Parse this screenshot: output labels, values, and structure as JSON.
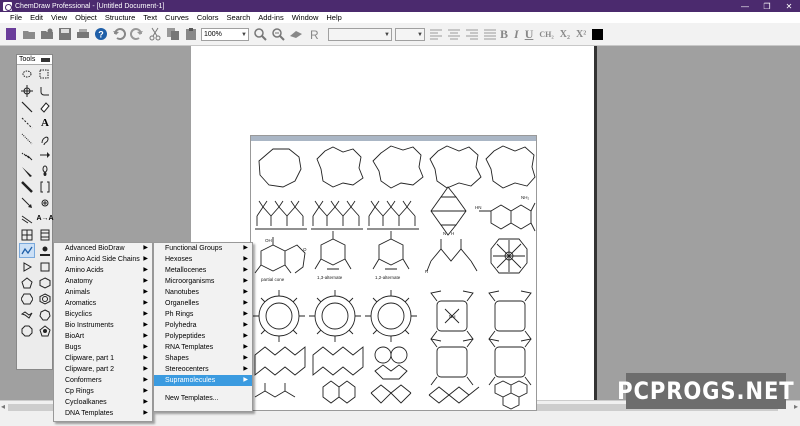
{
  "window": {
    "title": "ChemDraw Professional - [Untitled Document-1]",
    "minimize": "—",
    "maximize": "❐",
    "close": "✕"
  },
  "menubar": [
    "File",
    "Edit",
    "View",
    "Object",
    "Structure",
    "Text",
    "Curves",
    "Colors",
    "Search",
    "Add-ins",
    "Window",
    "Help"
  ],
  "toolbar": {
    "zoom_value": "100%",
    "font_value": "",
    "size_value": "",
    "bold": "B",
    "italic": "I",
    "underline": "U",
    "formula": "CH₂",
    "subscript": "X₂",
    "superscript": "X²",
    "text_color": "#000000"
  },
  "tools_palette": {
    "title": "Tools"
  },
  "templates_menu": {
    "items": [
      "Advanced BioDraw",
      "Amino Acid Side Chains",
      "Amino Acids",
      "Anatomy",
      "Animals",
      "Aromatics",
      "Bicyclics",
      "Bio Instruments",
      "BioArt",
      "Bugs",
      "Clipware, part 1",
      "Clipware, part 2",
      "Conformers",
      "Cp Rings",
      "Cycloalkanes",
      "DNA Templates"
    ]
  },
  "templates_submenu": {
    "items": [
      "Functional Groups",
      "Hexoses",
      "Metallocenes",
      "Microorganisms",
      "Nanotubes",
      "Organelles",
      "Ph Rings",
      "Polyhedra",
      "Polypeptides",
      "RNA Templates",
      "Shapes",
      "Stereocenters",
      "Supramolecules"
    ],
    "highlighted": "Supramolecules",
    "extra": "New Templates..."
  },
  "template_preview": {
    "labels": [
      "partial cone",
      "1,3-alternate",
      "1,2-alternate"
    ],
    "atom_labels": {
      "oh": "OH",
      "nh2": "NH₂",
      "nh": "NH",
      "n": "N",
      "h": "H",
      "hn": "HN",
      "o": "O",
      "r": "R"
    }
  },
  "watermark": "PCPROGS.NET",
  "colors": {
    "titlebar": "#4b2a6e",
    "highlight": "#3b9be0",
    "workspace": "#a0a0a0"
  }
}
